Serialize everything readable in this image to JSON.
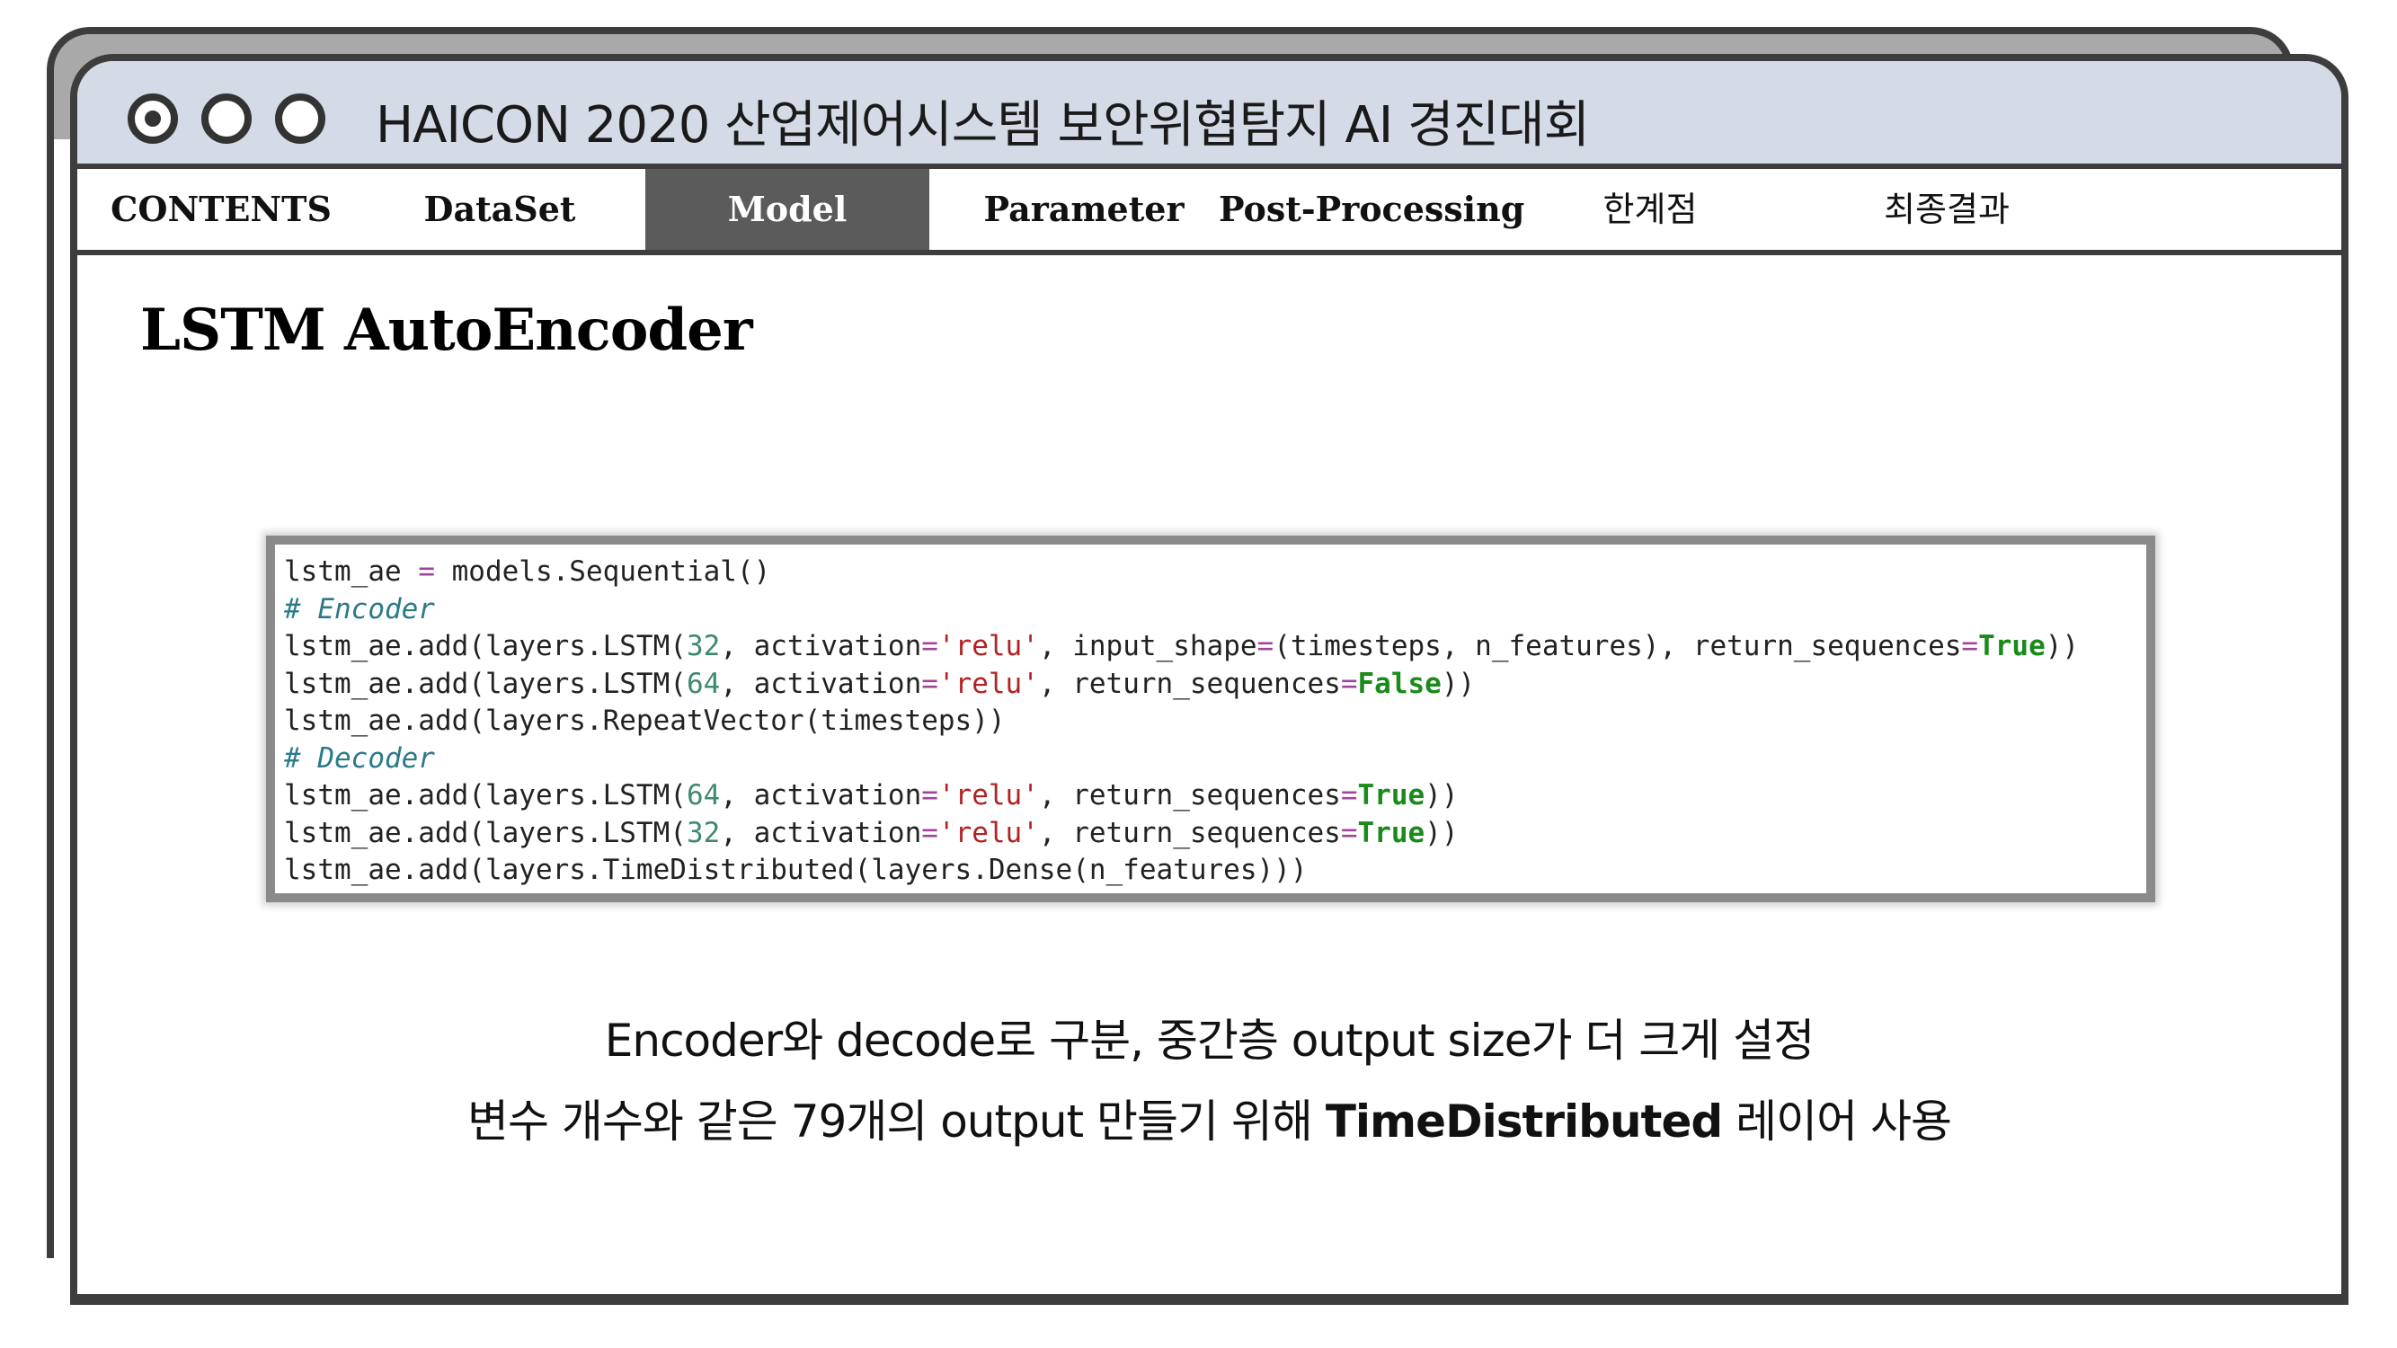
{
  "window": {
    "title": "HAICON 2020 산업제어시스템 보안위협탐지 AI 경진대회"
  },
  "nav": {
    "items": [
      {
        "label": "CONTENTS"
      },
      {
        "label": "DataSet"
      },
      {
        "label": "Model"
      },
      {
        "label": "Parameter"
      },
      {
        "label": "Post-Processing"
      },
      {
        "label": "한계점"
      },
      {
        "label": "최종결과"
      }
    ],
    "active_label": "Model"
  },
  "content": {
    "section_title": "LSTM AutoEncoder",
    "code": {
      "lines": [
        [
          {
            "t": "lstm_ae "
          },
          {
            "t": "=",
            "c": "op"
          },
          {
            "t": " models.Sequential()"
          }
        ],
        [
          {
            "t": "# Encoder",
            "c": "comment"
          }
        ],
        [
          {
            "t": "lstm_ae.add(layers.LSTM("
          },
          {
            "t": "32",
            "c": "num"
          },
          {
            "t": ", activation"
          },
          {
            "t": "=",
            "c": "op"
          },
          {
            "t": "'relu'",
            "c": "str"
          },
          {
            "t": ", input_shape"
          },
          {
            "t": "=",
            "c": "op"
          },
          {
            "t": "(timesteps, n_features), return_sequences"
          },
          {
            "t": "=",
            "c": "op"
          },
          {
            "t": "True",
            "c": "kw"
          },
          {
            "t": "))"
          }
        ],
        [
          {
            "t": "lstm_ae.add(layers.LSTM("
          },
          {
            "t": "64",
            "c": "num"
          },
          {
            "t": ", activation"
          },
          {
            "t": "=",
            "c": "op"
          },
          {
            "t": "'relu'",
            "c": "str"
          },
          {
            "t": ", return_sequences"
          },
          {
            "t": "=",
            "c": "op"
          },
          {
            "t": "False",
            "c": "kw"
          },
          {
            "t": "))"
          }
        ],
        [
          {
            "t": "lstm_ae.add(layers.RepeatVector(timesteps))"
          }
        ],
        [
          {
            "t": "# Decoder",
            "c": "comment"
          }
        ],
        [
          {
            "t": "lstm_ae.add(layers.LSTM("
          },
          {
            "t": "64",
            "c": "num"
          },
          {
            "t": ", activation"
          },
          {
            "t": "=",
            "c": "op"
          },
          {
            "t": "'relu'",
            "c": "str"
          },
          {
            "t": ", return_sequences"
          },
          {
            "t": "=",
            "c": "op"
          },
          {
            "t": "True",
            "c": "kw"
          },
          {
            "t": "))"
          }
        ],
        [
          {
            "t": "lstm_ae.add(layers.LSTM("
          },
          {
            "t": "32",
            "c": "num"
          },
          {
            "t": ", activation"
          },
          {
            "t": "=",
            "c": "op"
          },
          {
            "t": "'relu'",
            "c": "str"
          },
          {
            "t": ", return_sequences"
          },
          {
            "t": "=",
            "c": "op"
          },
          {
            "t": "True",
            "c": "kw"
          },
          {
            "t": "))"
          }
        ],
        [
          {
            "t": "lstm_ae.add(layers.TimeDistributed(layers.Dense(n_features)))"
          }
        ]
      ]
    },
    "description": {
      "line1": "Encoder와 decode로 구분, 중간층 output size가 더 크게 설정",
      "line2_before": "변수 개수와 같은 79개의 output 만들기 위해 ",
      "line2_strong": "TimeDistributed",
      "line2_after": " 레이어 사용"
    }
  },
  "colors": {
    "title_bar": "#d5dbe6",
    "active_tab": "#5b5b5b",
    "frame": "#3d3d3d",
    "code_number": "#3e8a6e",
    "code_string": "#b22222",
    "code_keyword": "#1a8a1a",
    "code_comment": "#2b7a8a"
  },
  "icons": [
    "window-record-icon",
    "window-circle-icon",
    "window-circle-icon"
  ]
}
